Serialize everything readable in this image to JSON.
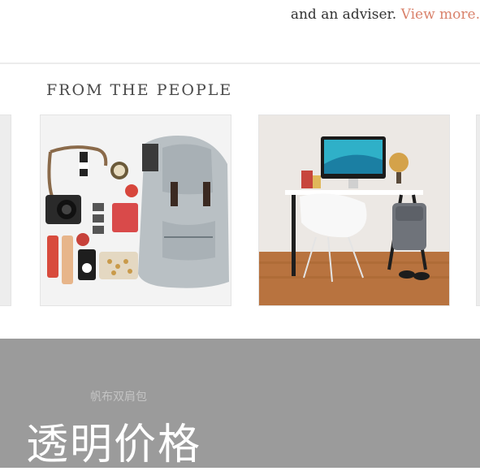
{
  "intro": {
    "text": "and an adviser.",
    "link": "View more."
  },
  "section": {
    "title": "FROM THE PEOPLE"
  },
  "promo": {
    "subtitle": "帆布双肩包",
    "title": "透明价格"
  },
  "colors": {
    "link": "#d9826b",
    "promo_bg": "#9b9b9b"
  }
}
